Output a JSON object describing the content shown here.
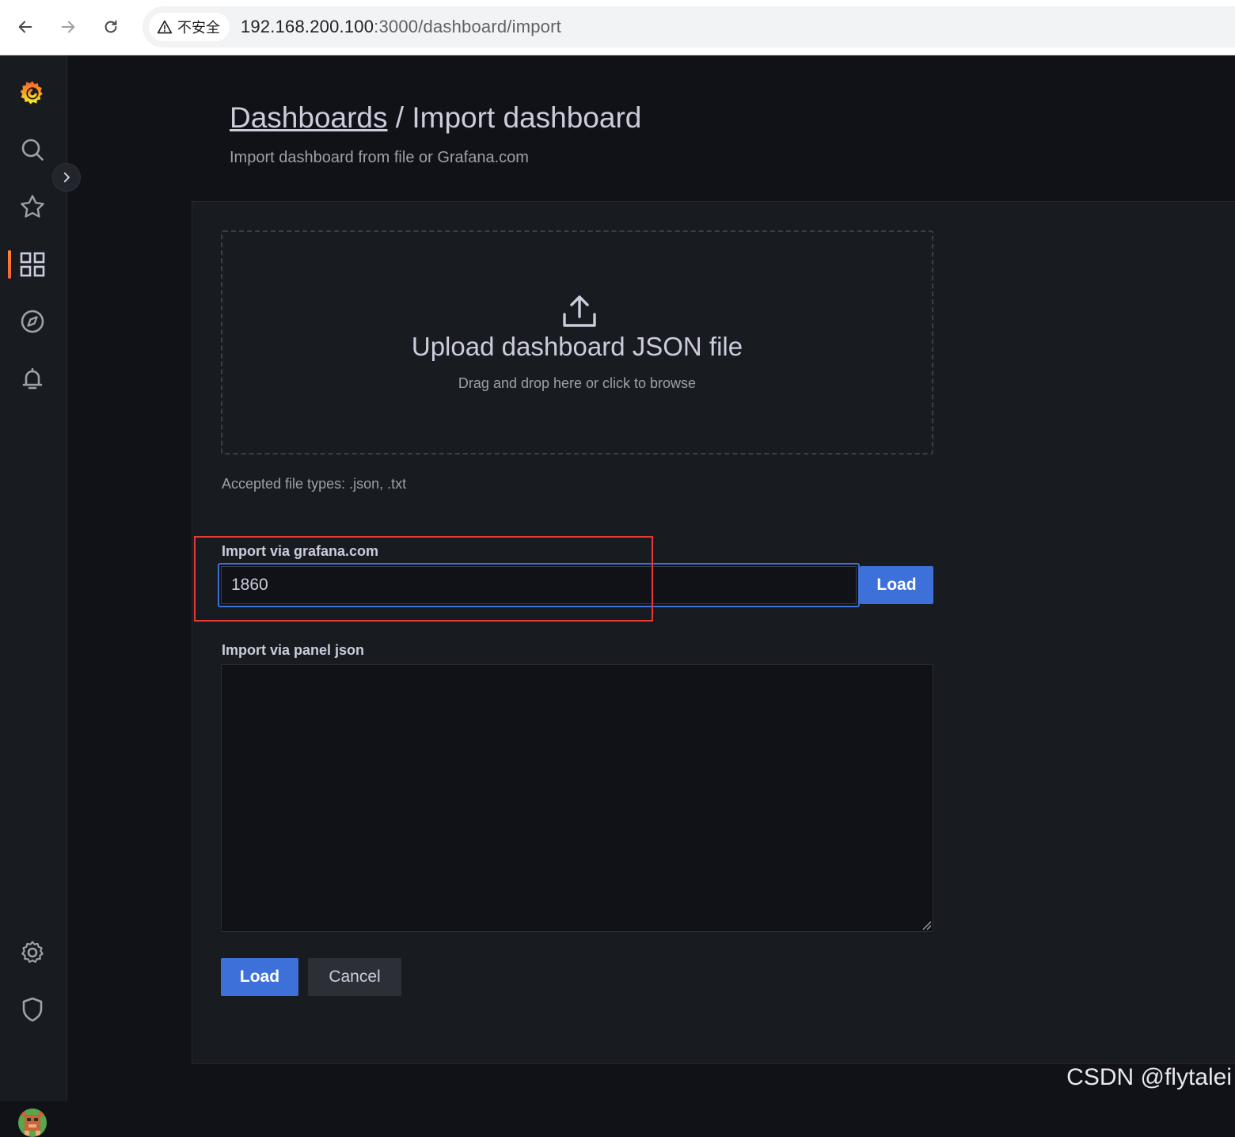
{
  "browser": {
    "security_label": "不安全",
    "url_host": "192.168.200.100",
    "url_path": ":3000/dashboard/import"
  },
  "sidebar": {
    "items": [
      {
        "icon": "grafana-logo-icon"
      },
      {
        "icon": "search-icon"
      },
      {
        "icon": "star-icon"
      },
      {
        "icon": "dashboards-icon",
        "active": true
      },
      {
        "icon": "explore-compass-icon"
      },
      {
        "icon": "alerting-bell-icon"
      },
      {
        "icon": "settings-gear-icon"
      },
      {
        "icon": "server-admin-shield-icon"
      },
      {
        "icon": "user-avatar"
      }
    ]
  },
  "page": {
    "breadcrumb_link": "Dashboards",
    "breadcrumb_separator": " / ",
    "title": "Import dashboard",
    "subtitle": "Import dashboard from file or Grafana.com"
  },
  "upload": {
    "title": "Upload dashboard JSON file",
    "hint": "Drag and drop here or click to browse",
    "accepted": "Accepted file types: .json, .txt"
  },
  "grafana_import": {
    "label": "Import via grafana.com",
    "value": "1860",
    "button": "Load"
  },
  "panel_json": {
    "label": "Import via panel json",
    "value": ""
  },
  "actions": {
    "load": "Load",
    "cancel": "Cancel"
  },
  "watermark": "CSDN @flytalei",
  "colors": {
    "background": "#111217",
    "panel": "#181b1f",
    "primary": "#3d71d9",
    "text": "#ccccdc",
    "annotation": "#e53935"
  }
}
